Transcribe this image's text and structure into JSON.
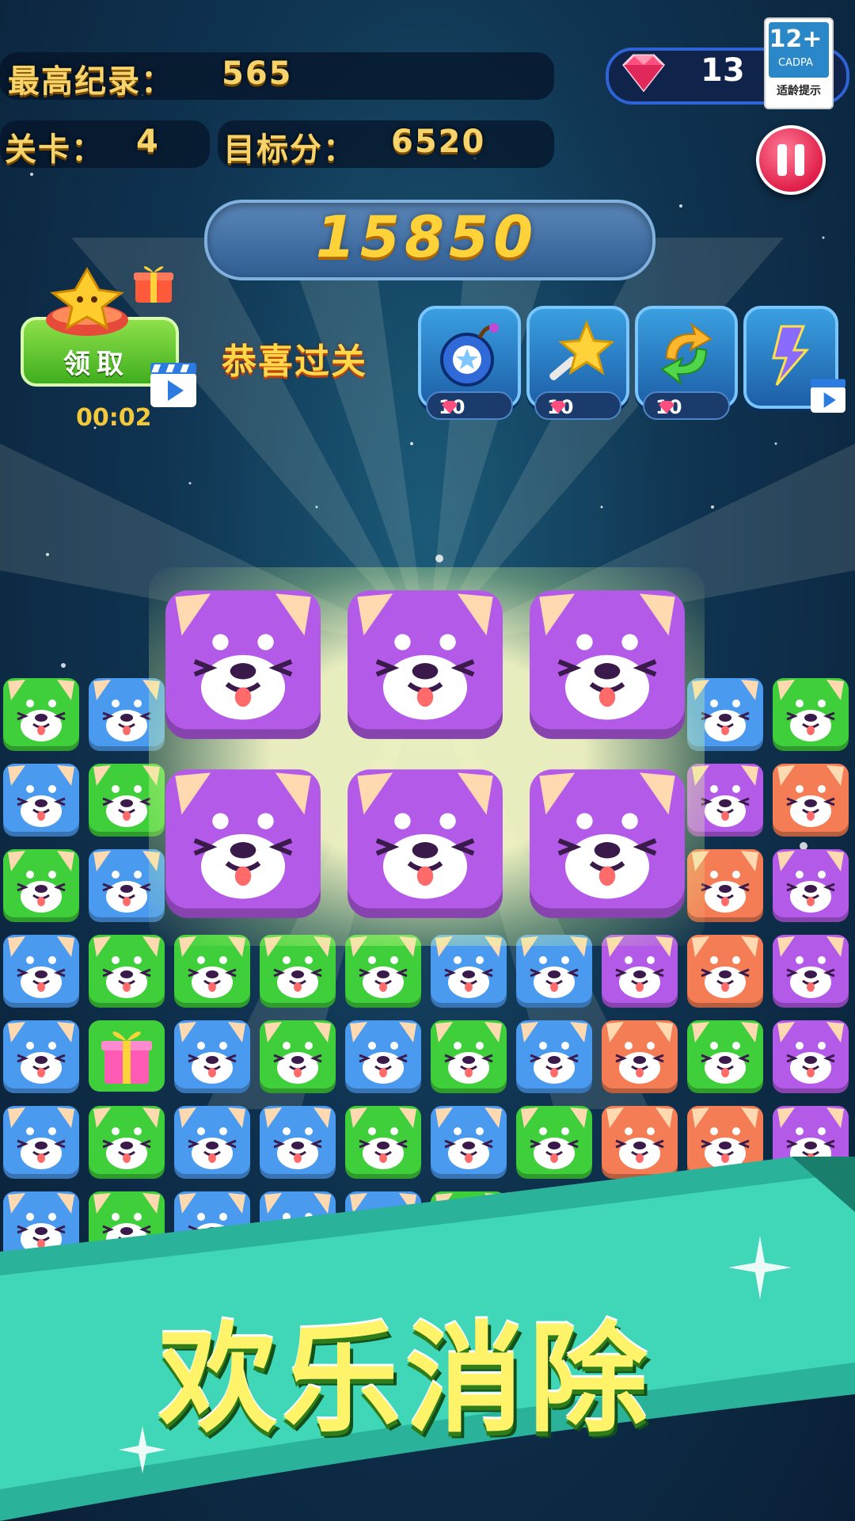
{
  "hud": {
    "best_label": "最高纪录：",
    "best_value": "565",
    "level_label": "关卡：",
    "level_value": "4",
    "target_label": "目标分：",
    "target_value": "6520",
    "gems": "13"
  },
  "age_rating": {
    "age": "12+",
    "org": "CADPA",
    "tip": "适龄提示"
  },
  "score": "15850",
  "claim": {
    "label": "领取",
    "timer": "00:02"
  },
  "congrats": "恭喜过关",
  "tools": [
    {
      "name": "bomb",
      "cost": "10"
    },
    {
      "name": "magic-star",
      "cost": "10"
    },
    {
      "name": "refresh",
      "cost": "10"
    },
    {
      "name": "lightning"
    }
  ],
  "banner": "欢乐消除",
  "colors": {
    "purple": "#b45ae8",
    "blue": "#4a9af0",
    "green": "#3fcf3a",
    "orange": "#f57d55",
    "gold": "#ffd23a"
  },
  "board_grid": [
    [
      "green",
      "blue",
      "",
      "",
      "",
      "",
      "",
      "",
      "blue",
      "green"
    ],
    [
      "blue",
      "green",
      "",
      "",
      "",
      "",
      "",
      "",
      "purple",
      "orange"
    ],
    [
      "green",
      "blue",
      "",
      "",
      "",
      "",
      "",
      "",
      "orange",
      "purple"
    ],
    [
      "blue",
      "green",
      "green",
      "green",
      "green",
      "blue",
      "blue",
      "purple",
      "orange",
      "purple"
    ],
    [
      "blue",
      "gift",
      "blue",
      "green",
      "blue",
      "green",
      "blue",
      "orange",
      "green",
      "purple"
    ],
    [
      "blue",
      "green",
      "blue",
      "blue",
      "green",
      "blue",
      "green",
      "orange",
      "orange",
      "purple"
    ],
    [
      "blue",
      "green",
      "blue",
      "blue",
      "blue",
      "green",
      "green",
      "green",
      "green",
      "purple"
    ],
    [
      "",
      "green",
      "blue",
      "green",
      "blue",
      "",
      "",
      "",
      "",
      ""
    ]
  ]
}
